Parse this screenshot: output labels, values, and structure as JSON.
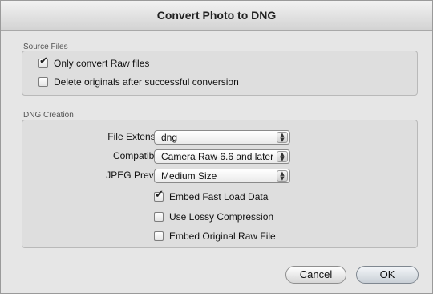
{
  "dialog": {
    "title": "Convert Photo to DNG",
    "source_files": {
      "label": "Source Files",
      "options": [
        {
          "label": "Only convert Raw files",
          "checked": true
        },
        {
          "label": "Delete originals after successful conversion",
          "checked": false
        }
      ]
    },
    "dng_creation": {
      "label": "DNG Creation",
      "file_extension": {
        "label": "File Extension:",
        "value": "dng"
      },
      "compatibility": {
        "label": "Compatibility:",
        "value": "Camera Raw 6.6 and later"
      },
      "jpeg_preview": {
        "label": "JPEG Preview:",
        "value": "Medium Size"
      },
      "options": [
        {
          "label": "Embed Fast Load Data",
          "checked": true
        },
        {
          "label": "Use Lossy Compression",
          "checked": false
        },
        {
          "label": "Embed Original Raw File",
          "checked": false
        }
      ]
    },
    "buttons": {
      "cancel": "Cancel",
      "ok": "OK"
    }
  }
}
